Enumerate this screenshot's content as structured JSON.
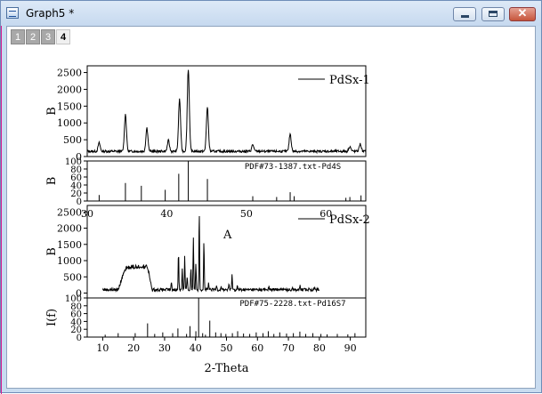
{
  "window": {
    "title": "Graph5 *",
    "icon": "graph-window-icon",
    "controls": {
      "minimize": "minimize-icon",
      "maximize": "maximize-icon",
      "close": "close-icon",
      "close_glyph": "✕"
    }
  },
  "layer_tabs": [
    {
      "label": "1",
      "active": false
    },
    {
      "label": "2",
      "active": false
    },
    {
      "label": "3",
      "active": false
    },
    {
      "label": "4",
      "active": true
    }
  ],
  "chart_data": [
    {
      "panel": "top-pattern",
      "type": "line",
      "series": [
        {
          "name": "PdSx-1",
          "peaks": [
            [
              31.5,
              250
            ],
            [
              34.8,
              1100
            ],
            [
              37.5,
              700
            ],
            [
              40.2,
              320
            ],
            [
              41.6,
              1550
            ],
            [
              42.7,
              2450
            ],
            [
              45.1,
              1300
            ],
            [
              50.8,
              200
            ],
            [
              55.5,
              520
            ],
            [
              63.0,
              150
            ],
            [
              64.3,
              220
            ]
          ]
        }
      ],
      "ylabel": "B",
      "ylim": [
        0,
        2700
      ],
      "yticks": [
        0,
        500,
        1000,
        1500,
        2000,
        2500
      ],
      "xlim": [
        30,
        65
      ],
      "x_tick_labels": [
        "30",
        "40",
        "50",
        "60"
      ],
      "legend": {
        "label": "PdSx-1",
        "position": "top-right"
      }
    },
    {
      "panel": "top-reference",
      "type": "bar",
      "title": "PDF#73-1387.txt-Pd4S",
      "ylabel": "B",
      "ylim": [
        0,
        100
      ],
      "yticks": [
        0,
        20,
        40,
        60,
        80,
        100
      ],
      "sticks": [
        [
          31.5,
          15
        ],
        [
          34.8,
          45
        ],
        [
          36.8,
          38
        ],
        [
          39.8,
          28
        ],
        [
          41.5,
          68
        ],
        [
          42.7,
          100
        ],
        [
          45.1,
          55
        ],
        [
          50.8,
          12
        ],
        [
          53.8,
          10
        ],
        [
          55.5,
          22
        ],
        [
          56.0,
          12
        ],
        [
          62.5,
          8
        ],
        [
          63.0,
          10
        ],
        [
          64.4,
          14
        ]
      ]
    },
    {
      "panel": "bottom-pattern",
      "type": "line",
      "series": [
        {
          "name": "PdSx-2",
          "hump": {
            "from": 15,
            "to": 26,
            "height": 720
          },
          "peaks": [
            [
              32.2,
              250
            ],
            [
              34.5,
              1200
            ],
            [
              35.7,
              680
            ],
            [
              36.5,
              1050
            ],
            [
              37.3,
              420
            ],
            [
              38.5,
              700
            ],
            [
              39.3,
              1650
            ],
            [
              40.1,
              820
            ],
            [
              41.2,
              2500
            ],
            [
              42.7,
              1520
            ],
            [
              44.2,
              200
            ],
            [
              46.8,
              150
            ],
            [
              48.3,
              120
            ],
            [
              50.8,
              180
            ],
            [
              51.8,
              480
            ],
            [
              53.5,
              120
            ],
            [
              63.7,
              100
            ],
            [
              67.5,
              80
            ],
            [
              71.3,
              90
            ],
            [
              73.8,
              120
            ],
            [
              76.8,
              80
            ],
            [
              78.6,
              70
            ]
          ]
        }
      ],
      "ylabel": "B",
      "ylim": [
        -150,
        2700
      ],
      "yticks": [
        0,
        500,
        1000,
        1500,
        2000,
        2500
      ],
      "xlim": [
        5,
        95
      ],
      "annotation": "A",
      "legend": {
        "label": "PdSx-2",
        "position": "top-right"
      }
    },
    {
      "panel": "bottom-reference",
      "type": "bar",
      "title": "PDF#75-2228.txt-Pd16S7",
      "ylabel": "I(f)",
      "xlabel": "2-Theta",
      "xlim": [
        5,
        95
      ],
      "ylim": [
        0,
        100
      ],
      "yticks": [
        0,
        20,
        40,
        60,
        80,
        100
      ],
      "xticks": [
        10,
        20,
        30,
        40,
        50,
        60,
        70,
        80,
        90
      ],
      "sticks": [
        [
          10.8,
          6
        ],
        [
          15.0,
          10
        ],
        [
          20.5,
          10
        ],
        [
          24.5,
          35
        ],
        [
          26.8,
          8
        ],
        [
          29.4,
          12
        ],
        [
          32.6,
          10
        ],
        [
          34.3,
          22
        ],
        [
          37.1,
          8
        ],
        [
          38.2,
          28
        ],
        [
          40.1,
          15
        ],
        [
          41.0,
          100
        ],
        [
          42.3,
          10
        ],
        [
          43.2,
          6
        ],
        [
          44.6,
          42
        ],
        [
          46.5,
          12
        ],
        [
          48.2,
          10
        ],
        [
          49.8,
          8
        ],
        [
          51.9,
          10
        ],
        [
          53.6,
          15
        ],
        [
          55.5,
          9
        ],
        [
          57.5,
          8
        ],
        [
          59.6,
          12
        ],
        [
          61.8,
          10
        ],
        [
          63.5,
          15
        ],
        [
          65.3,
          8
        ],
        [
          67.2,
          12
        ],
        [
          69.4,
          9
        ],
        [
          71.6,
          10
        ],
        [
          73.7,
          14
        ],
        [
          75.6,
          8
        ],
        [
          77.9,
          10
        ],
        [
          80.5,
          8
        ],
        [
          82.5,
          7
        ],
        [
          85.8,
          8
        ],
        [
          89.2,
          7
        ],
        [
          91.5,
          10
        ]
      ]
    }
  ]
}
